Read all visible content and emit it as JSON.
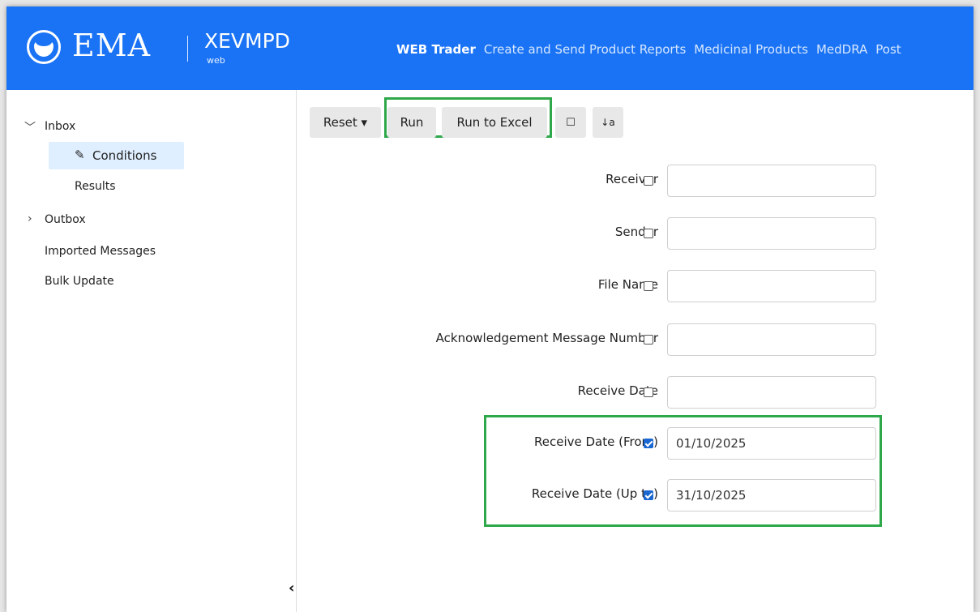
{
  "header": {
    "brand": "EMA",
    "product": "XEVMPD",
    "product_sub": "web",
    "nav": [
      {
        "label": "WEB Trader",
        "active": true
      },
      {
        "label": "Create and Send Product Reports",
        "active": false
      },
      {
        "label": "Medicinal Products",
        "active": false
      },
      {
        "label": "MedDRA",
        "active": false
      },
      {
        "label": "Post",
        "active": false
      }
    ]
  },
  "sidebar": {
    "inbox": "Inbox",
    "conditions": "Conditions",
    "results": "Results",
    "outbox": "Outbox",
    "imported": "Imported Messages",
    "bulk": "Bulk Update",
    "collapse_icon": "‹"
  },
  "toolbar": {
    "reset": "Reset ▾",
    "run": "Run",
    "run_excel": "Run to Excel",
    "square_icon": "☐",
    "sort_icon": "↓a"
  },
  "form": {
    "fields": [
      {
        "label": "Receiver",
        "checked": false,
        "value": ""
      },
      {
        "label": "Sender",
        "checked": false,
        "value": ""
      },
      {
        "label": "File Name",
        "checked": false,
        "value": ""
      },
      {
        "label": "Acknowledgement Message Number",
        "checked": false,
        "value": ""
      },
      {
        "label": "Receive Date",
        "checked": false,
        "value": ""
      },
      {
        "label": "Receive Date (From)",
        "checked": true,
        "value": "01/10/2025"
      },
      {
        "label": "Receive Date (Up to)",
        "checked": true,
        "value": "31/10/2025"
      }
    ]
  },
  "colors": {
    "header_bg": "#1a73f5",
    "highlight": "#2ea84a",
    "selected_bg": "#dfefff"
  }
}
